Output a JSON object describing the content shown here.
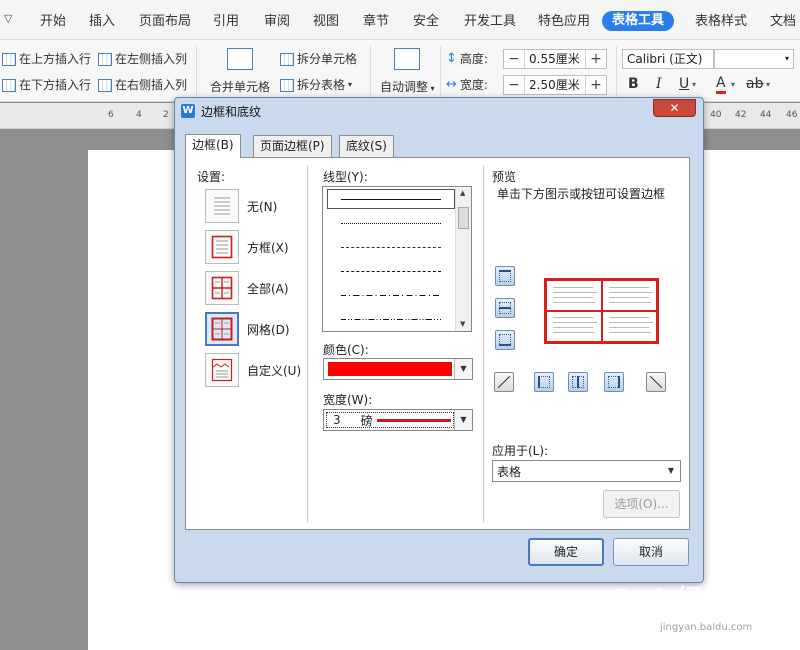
{
  "ribbon": {
    "tabs": [
      "开始",
      "插入",
      "页面布局",
      "引用",
      "审阅",
      "视图",
      "章节",
      "安全",
      "开发工具",
      "特色应用",
      "表格工具",
      "表格样式",
      "文档"
    ],
    "active_tab": "表格工具",
    "insert_above": "在上方插入行",
    "insert_below": "在下方插入行",
    "insert_left": "在左侧插入列",
    "insert_right": "在右侧插入列",
    "merge_cells": "合并单元格",
    "split_cells": "拆分单元格",
    "split_table": "拆分表格",
    "auto_fit": "自动调整",
    "height_label": "高度:",
    "height_value": "0.55厘米",
    "width_label": "宽度:",
    "width_value": "2.50厘米",
    "font_name": "Calibri (正文)",
    "bold": "B",
    "italic": "I",
    "underline": "U",
    "font_color": "A",
    "minus": "−",
    "plus": "+"
  },
  "ruler": [
    "6",
    "4",
    "2",
    "40",
    "42",
    "44",
    "46"
  ],
  "dialog": {
    "title": "边框和底纹",
    "close": "✕",
    "tabs": [
      "边框(B)",
      "页面边框(P)",
      "底纹(S)"
    ],
    "settings_label": "设置:",
    "settings": [
      "无(N)",
      "方框(X)",
      "全部(A)",
      "网格(D)",
      "自定义(U)"
    ],
    "line_style_label": "线型(Y):",
    "color_label": "颜色(C):",
    "color_value": "#ff0000",
    "width_label": "宽度(W):",
    "width_value": "3",
    "width_unit": "磅",
    "preview_label": "预览",
    "preview_hint": "单击下方图示或按钮可设置边框",
    "apply_label": "应用于(L):",
    "apply_value": "表格",
    "options_button": "选项(O)...",
    "ok_button": "确定",
    "cancel_button": "取消"
  },
  "watermark": {
    "brand": "Bai 经验",
    "url": "jingyan.baidu.com"
  },
  "colors": {
    "accent": "#2b7de9",
    "border_red": "#ff0000"
  }
}
